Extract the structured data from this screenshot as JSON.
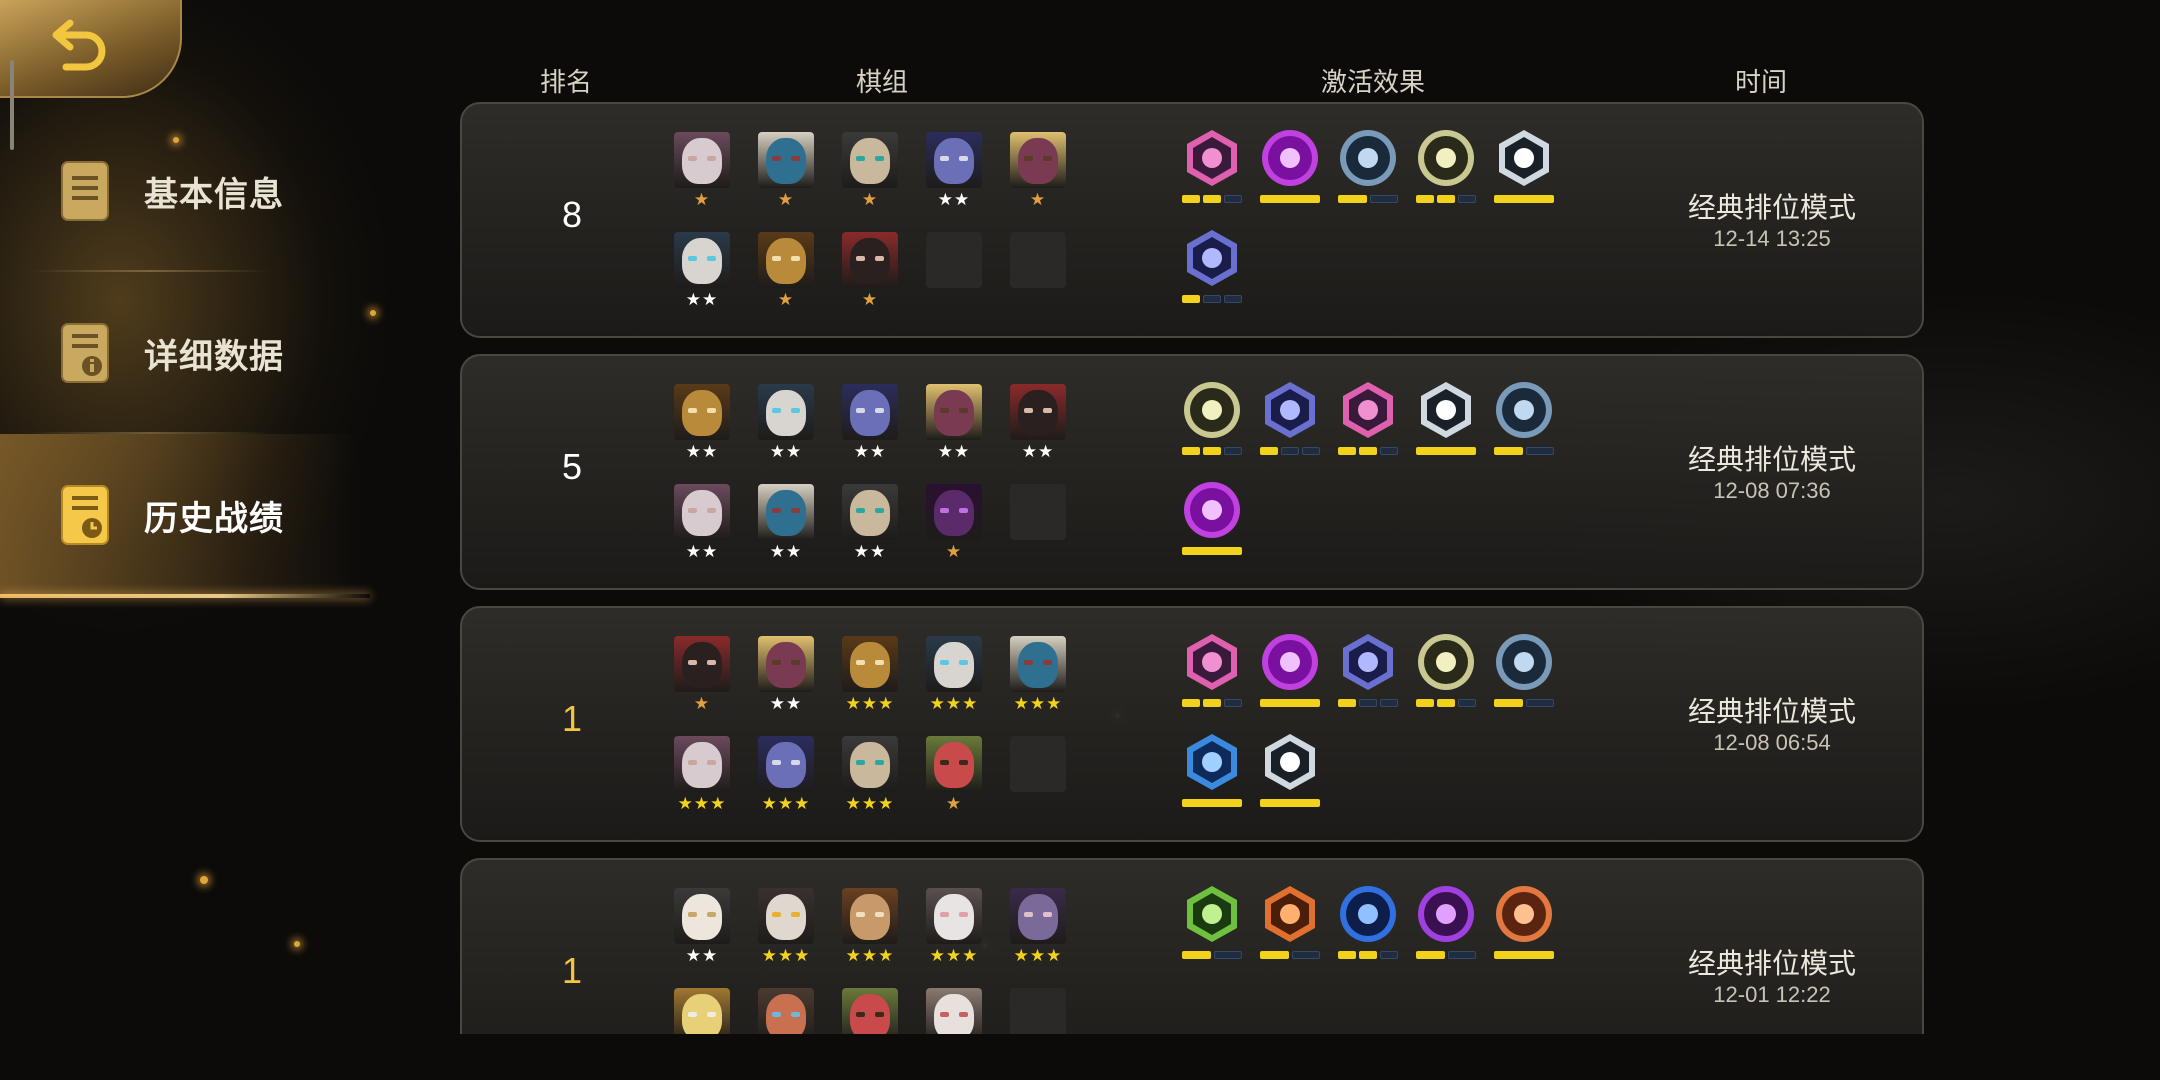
{
  "header": {
    "rank": "排名",
    "lineup": "棋组",
    "traits": "激活效果",
    "time": "时间"
  },
  "sidebar": {
    "items": [
      {
        "label": "基本信息",
        "icon": "document-icon",
        "active": false
      },
      {
        "label": "详细数据",
        "icon": "document-info-icon",
        "active": false
      },
      {
        "label": "历史战绩",
        "icon": "document-clock-icon",
        "active": true
      }
    ]
  },
  "colors": {
    "accent_gold": "#f3c63f",
    "bar_on": "#f3d21c",
    "star_gold": "#e0a040",
    "star_white": "#ffffff"
  },
  "matches": [
    {
      "rank": "8",
      "gold": false,
      "mode": "经典排位模式",
      "time": "12-14 13:25",
      "units": [
        {
          "icon": "white-hood-hero-icon",
          "stars": 1
        },
        {
          "icon": "horned-demon-icon",
          "stars": 1
        },
        {
          "icon": "bald-cyborg-icon",
          "stars": 1
        },
        {
          "icon": "werewolf-icon",
          "stars": 2
        },
        {
          "icon": "bull-warrior-icon",
          "stars": 1
        },
        {
          "icon": "yeti-icon",
          "stars": 2
        },
        {
          "icon": "wooden-mask-icon",
          "stars": 1
        },
        {
          "icon": "dark-hair-hero-icon",
          "stars": 1
        },
        {
          "icon": "empty-slot",
          "stars": 0
        },
        {
          "icon": "empty-slot",
          "stars": 0
        }
      ],
      "traits": [
        {
          "icon": "knight-icon",
          "segs": 3,
          "on": 2
        },
        {
          "icon": "demon-skull-icon",
          "segs": 1,
          "on": 1
        },
        {
          "icon": "paw-icon",
          "segs": 2,
          "on": 1
        },
        {
          "icon": "feline-icon",
          "segs": 3,
          "on": 2
        },
        {
          "icon": "cross-icon",
          "segs": 1,
          "on": 1
        },
        {
          "icon": "mech-icon",
          "segs": 3,
          "on": 1
        }
      ]
    },
    {
      "rank": "5",
      "gold": false,
      "mode": "经典排位模式",
      "time": "12-08 07:36",
      "units": [
        {
          "icon": "wooden-mask-icon",
          "stars": 2
        },
        {
          "icon": "yeti-icon",
          "stars": 2
        },
        {
          "icon": "werewolf-icon",
          "stars": 2
        },
        {
          "icon": "bull-warrior-icon",
          "stars": 2
        },
        {
          "icon": "dark-hair-hero-icon",
          "stars": 2
        },
        {
          "icon": "white-hood-hero-icon",
          "stars": 2
        },
        {
          "icon": "horned-demon-icon",
          "stars": 2
        },
        {
          "icon": "bald-cyborg-icon",
          "stars": 2
        },
        {
          "icon": "purple-assassin-icon",
          "stars": 1
        },
        {
          "icon": "empty-slot",
          "stars": 0
        }
      ],
      "traits": [
        {
          "icon": "feline-icon",
          "segs": 3,
          "on": 2
        },
        {
          "icon": "mech-icon",
          "segs": 3,
          "on": 1
        },
        {
          "icon": "knight-icon",
          "segs": 3,
          "on": 2
        },
        {
          "icon": "cross-icon",
          "segs": 1,
          "on": 1
        },
        {
          "icon": "paw-icon",
          "segs": 2,
          "on": 1
        },
        {
          "icon": "demon-skull-icon",
          "segs": 1,
          "on": 1
        }
      ]
    },
    {
      "rank": "1",
      "gold": true,
      "mode": "经典排位模式",
      "time": "12-08 06:54",
      "units": [
        {
          "icon": "dark-hair-hero-icon",
          "stars": 1,
          "gold": true
        },
        {
          "icon": "bull-warrior-icon",
          "stars": 2
        },
        {
          "icon": "wooden-mask-icon",
          "stars": 3
        },
        {
          "icon": "yeti-icon",
          "stars": 3
        },
        {
          "icon": "horned-demon-icon",
          "stars": 3
        },
        {
          "icon": "white-hood-hero-icon",
          "stars": 3
        },
        {
          "icon": "werewolf-icon",
          "stars": 3
        },
        {
          "icon": "bald-cyborg-icon",
          "stars": 3
        },
        {
          "icon": "red-hood-icon",
          "stars": 1,
          "gold": true
        },
        {
          "icon": "empty-slot",
          "stars": 0
        }
      ],
      "traits": [
        {
          "icon": "knight-icon",
          "segs": 3,
          "on": 2
        },
        {
          "icon": "demon-skull-icon",
          "segs": 1,
          "on": 1
        },
        {
          "icon": "mech-icon",
          "segs": 3,
          "on": 1
        },
        {
          "icon": "feline-icon",
          "segs": 3,
          "on": 2
        },
        {
          "icon": "paw-icon",
          "segs": 2,
          "on": 1
        },
        {
          "icon": "blade-icon",
          "segs": 1,
          "on": 1
        },
        {
          "icon": "cross-icon",
          "segs": 1,
          "on": 1
        }
      ]
    },
    {
      "rank": "1",
      "gold": true,
      "mode": "经典排位模式",
      "time": "12-01 12:22",
      "units": [
        {
          "icon": "white-bird-icon",
          "stars": 2
        },
        {
          "icon": "eyepatch-eagle-icon",
          "stars": 3
        },
        {
          "icon": "owl-icon",
          "stars": 3
        },
        {
          "icon": "white-rabbit-icon",
          "stars": 3
        },
        {
          "icon": "purple-hooded-icon",
          "stars": 3
        },
        {
          "icon": "golden-helm-icon",
          "stars": 0
        },
        {
          "icon": "goggles-dwarf-icon",
          "stars": 0
        },
        {
          "icon": "red-hood-icon",
          "stars": 0
        },
        {
          "icon": "old-sage-icon",
          "stars": 0
        },
        {
          "icon": "empty-slot",
          "stars": 0
        }
      ],
      "traits": [
        {
          "icon": "bow-icon",
          "segs": 2,
          "on": 1
        },
        {
          "icon": "leaf-icon",
          "segs": 2,
          "on": 1
        },
        {
          "icon": "feather-icon",
          "segs": 3,
          "on": 2
        },
        {
          "icon": "serpent-icon",
          "segs": 2,
          "on": 1
        },
        {
          "icon": "viking-icon",
          "segs": 1,
          "on": 1
        }
      ]
    }
  ]
}
